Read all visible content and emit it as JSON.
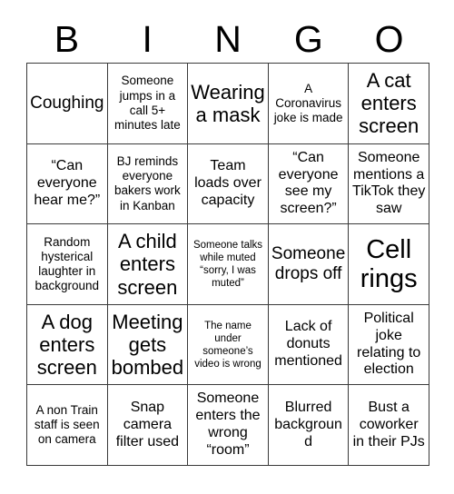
{
  "header": {
    "letters": [
      "B",
      "I",
      "N",
      "G",
      "O"
    ]
  },
  "grid": {
    "rows": [
      [
        {
          "text": "Coughing",
          "size": "lg"
        },
        {
          "text": "Someone jumps in a call 5+ minutes late",
          "size": "sm"
        },
        {
          "text": "Wearing a mask",
          "size": "xl"
        },
        {
          "text": "A Coronavirus joke is made",
          "size": "sm"
        },
        {
          "text": "A cat enters screen",
          "size": "xl"
        }
      ],
      [
        {
          "text": "“Can everyone hear me?”",
          "size": "md"
        },
        {
          "text": "BJ reminds everyone bakers work in Kanban",
          "size": "sm"
        },
        {
          "text": "Team loads over capacity",
          "size": "md"
        },
        {
          "text": "“Can everyone see my screen?”",
          "size": "md"
        },
        {
          "text": "Someone mentions a TikTok they saw",
          "size": "md"
        }
      ],
      [
        {
          "text": "Random hysterical laughter in background",
          "size": "sm"
        },
        {
          "text": "A child enters screen",
          "size": "xl"
        },
        {
          "text": "Someone talks while muted “sorry, I was muted”",
          "size": "xs"
        },
        {
          "text": "Someone drops off",
          "size": "lg"
        },
        {
          "text": "Cell rings",
          "size": "xxl"
        }
      ],
      [
        {
          "text": "A dog enters screen",
          "size": "xl"
        },
        {
          "text": "Meeting gets bombed",
          "size": "xl"
        },
        {
          "text": "The name under someone’s video is wrong",
          "size": "xs"
        },
        {
          "text": "Lack of donuts mentioned",
          "size": "md"
        },
        {
          "text": "Political joke relating to election",
          "size": "md"
        }
      ],
      [
        {
          "text": "A non Train staff is seen on camera",
          "size": "sm"
        },
        {
          "text": "Snap camera filter used",
          "size": "md"
        },
        {
          "text": "Someone enters the wrong “room”",
          "size": "md"
        },
        {
          "text": "Blurred background",
          "size": "md"
        },
        {
          "text": "Bust a coworker in their PJs",
          "size": "md"
        }
      ]
    ]
  },
  "colors": {
    "background": "#ffffff",
    "text": "#000000",
    "border": "#3a3a3a"
  }
}
